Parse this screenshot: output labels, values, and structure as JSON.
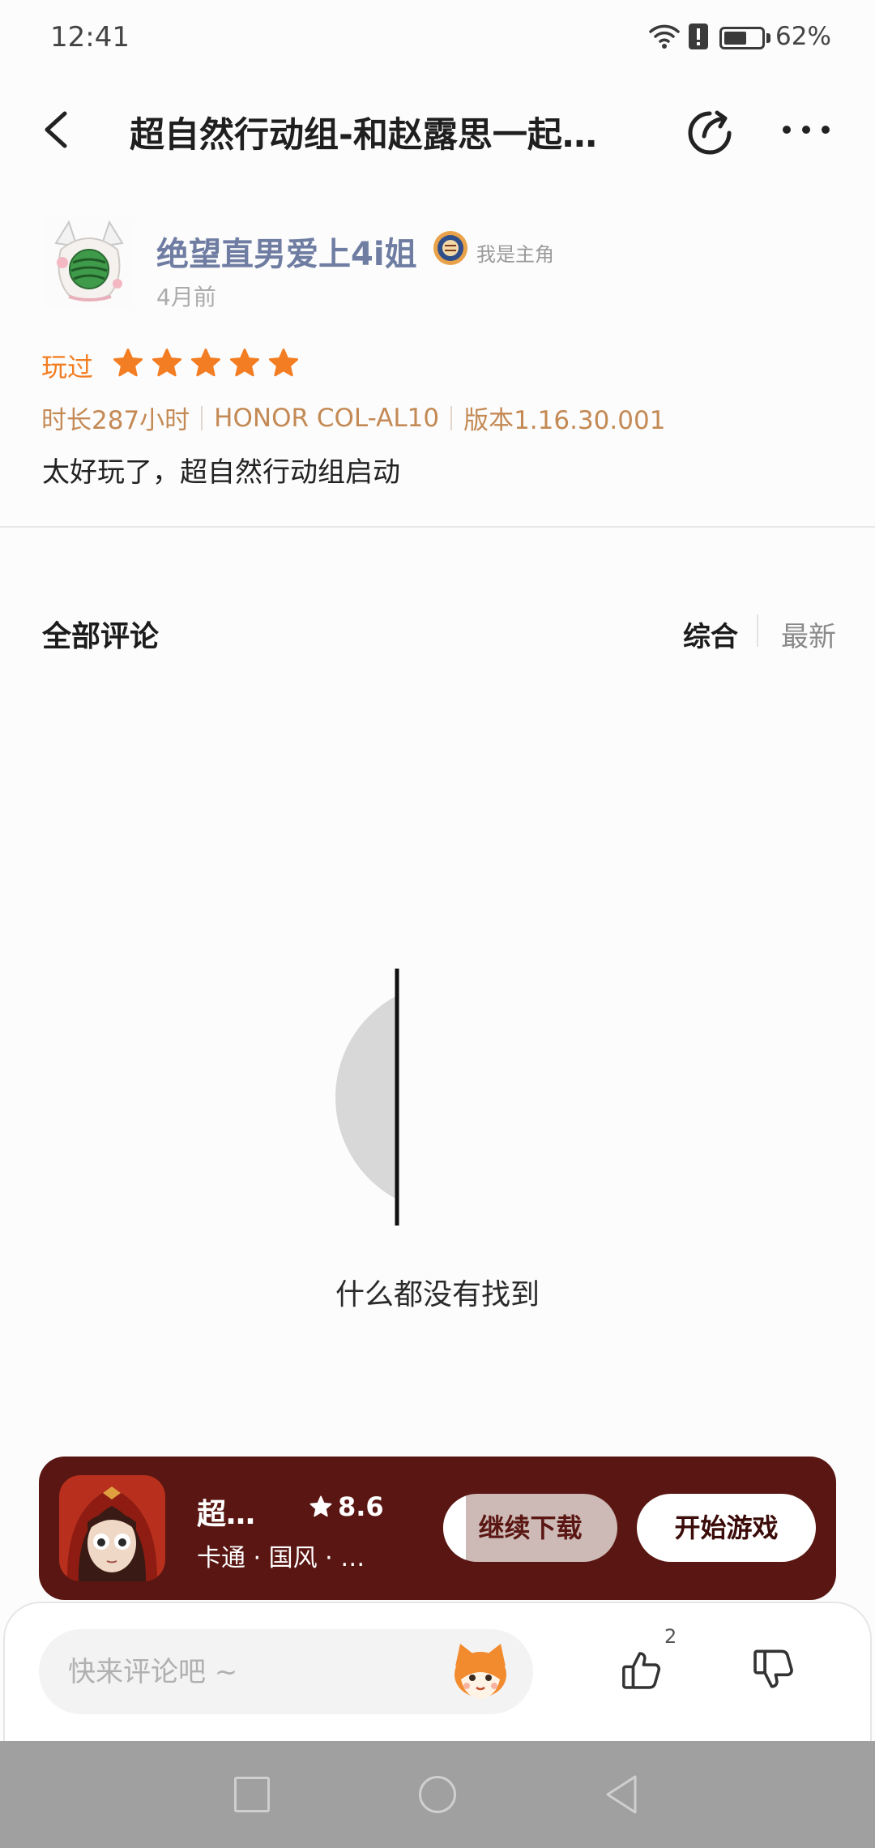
{
  "status_bar": {
    "time": "12:41",
    "battery": "62%"
  },
  "header": {
    "title": "超自然行动组-和赵露思一起…"
  },
  "review": {
    "user": {
      "name": "绝望直男爱上4i姐",
      "badge_label": "我是主角",
      "time_ago": "4月前"
    },
    "played_label": "玩过",
    "rating": 5,
    "meta": [
      "时长287小时",
      "HONOR COL-AL10",
      "版本1.16.30.001"
    ],
    "content": "太好玩了，超自然行动组启动"
  },
  "comments": {
    "title": "全部评论",
    "sort_options": [
      "综合",
      "最新"
    ],
    "active_sort": "综合",
    "empty_text": "什么都没有找到"
  },
  "game_banner": {
    "name": "超…",
    "rating": "8.6",
    "tags": "卡通 · 国风 · …",
    "download_label": "继续下载",
    "download_progress": 0.13,
    "play_label": "开始游戏"
  },
  "bottom_bar": {
    "comment_placeholder": "快来评论吧 ~",
    "like_count": "2"
  },
  "icons": {
    "status": [
      "wifi-icon",
      "alert-icon",
      "battery-icon"
    ],
    "header": [
      "back-arrow-icon",
      "share-icon",
      "more-icon"
    ],
    "bottom": [
      "mascot-emoji-icon",
      "thumbs-up-icon",
      "thumbs-down-icon"
    ],
    "nav": [
      "recents-icon",
      "home-icon",
      "back-icon"
    ]
  },
  "colors": {
    "accent_orange": "#f37d22",
    "meta_text": "#c48a55",
    "username": "#6f7da2",
    "banner_bg": "#5a1612",
    "nav_bar": "#a0a0a0"
  }
}
